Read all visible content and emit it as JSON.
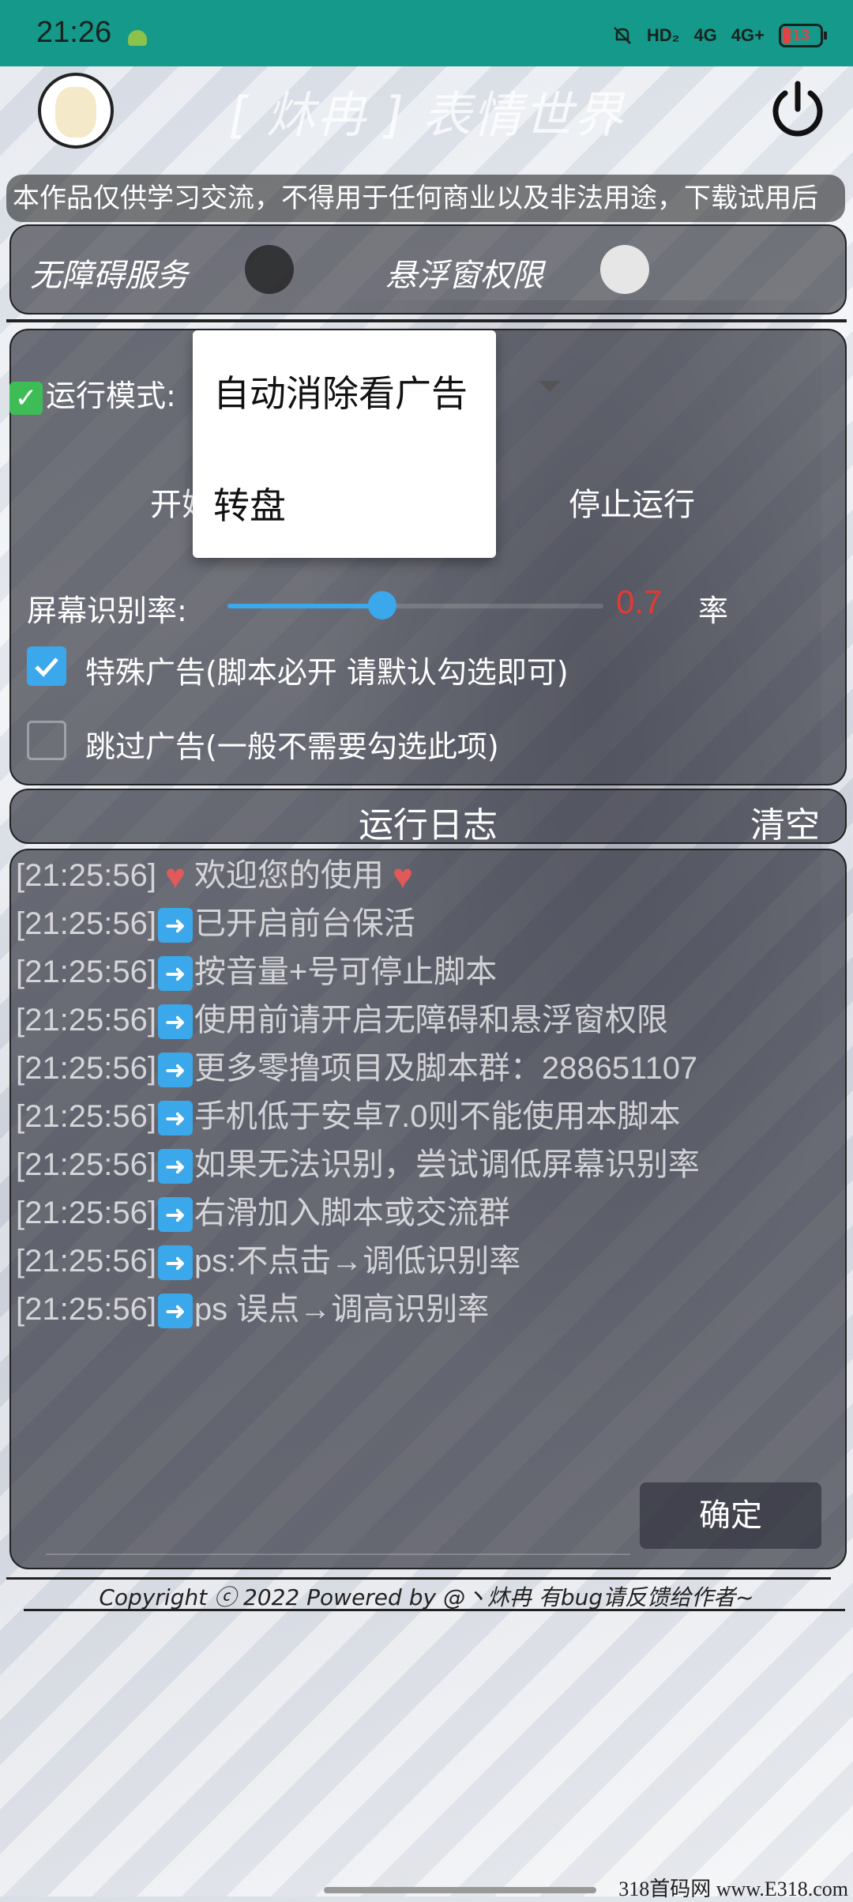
{
  "status_bar": {
    "time": "21:26",
    "net1": "HD₂",
    "net2": "4G",
    "net3": "4G+",
    "battery": "13"
  },
  "header": {
    "title": "[ 炑冉 ] 表情世界",
    "avatar": "avatar",
    "power": "power-icon"
  },
  "notice": "本作品仅供学习交流，不得用于任何商业以及非法用途，下载试用后",
  "permissions": {
    "accessibility_label": "无障碍服务",
    "overlay_label": "悬浮窗权限"
  },
  "controls": {
    "mode_label": "运行模式:",
    "start_label": "开始",
    "stop_label": "停止运行",
    "rate_label": "屏幕识别率:",
    "rate_value": "0.7",
    "rate_fraction": 0.4,
    "rate_unit": "率",
    "special_ads_label": "特殊广告(脚本必开 请默认勾选即可)",
    "special_ads_checked": true,
    "skip_ads_label": "跳过广告(一般不需要勾选此项)",
    "skip_ads_checked": false
  },
  "dropdown": {
    "options": [
      "自动消除看广告",
      "转盘"
    ]
  },
  "log": {
    "title": "运行日志",
    "clear_label": "清空",
    "ok_label": "确定",
    "entries": [
      {
        "time": "[21:25:56]",
        "icon": "heart-icon",
        "text": "欢迎您的使用",
        "suffix_icon": "heart-icon"
      },
      {
        "time": "[21:25:56]",
        "icon": "arrow-right-icon",
        "text": "已开启前台保活"
      },
      {
        "time": "[21:25:56]",
        "icon": "arrow-right-icon",
        "text": "按音量+号可停止脚本"
      },
      {
        "time": "[21:25:56]",
        "icon": "arrow-right-icon",
        "text": "使用前请开启无障碍和悬浮窗权限"
      },
      {
        "time": "[21:25:56]",
        "icon": "arrow-right-icon",
        "text": "更多零撸项目及脚本群：288651107"
      },
      {
        "time": "[21:25:56]",
        "icon": "arrow-right-icon",
        "text": "手机低于安卓7.0则不能使用本脚本"
      },
      {
        "time": "[21:25:56]",
        "icon": "arrow-right-icon",
        "text": "如果无法识别，尝试调低屏幕识别率"
      },
      {
        "time": "[21:25:56]",
        "icon": "arrow-right-icon",
        "text": "右滑加入脚本或交流群"
      },
      {
        "time": "[21:25:56]",
        "icon": "arrow-right-icon",
        "text": "ps:不点击→调低识别率"
      },
      {
        "time": "[21:25:56]",
        "icon": "arrow-right-icon",
        "text": "ps 误点→调高识别率"
      }
    ]
  },
  "footer": {
    "copyright": "Copyright ⓒ 2022   Powered by @丶炑冉  有bug请反馈给作者~"
  },
  "watermark": "318首码网 www.E318.com",
  "colors": {
    "status_bar": "#14998a",
    "accent": "#3aa8ea",
    "rate_value": "#e53935"
  }
}
